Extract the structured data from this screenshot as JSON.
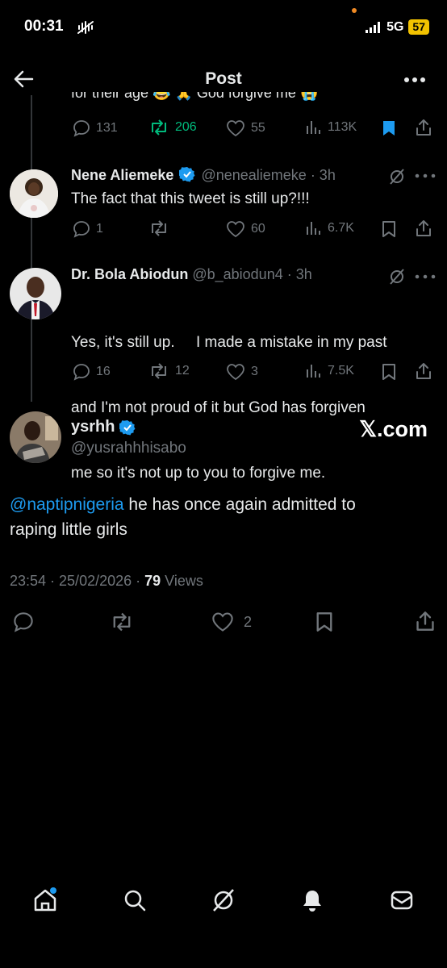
{
  "status_bar": {
    "time": "00:31",
    "network": "5G",
    "battery": "57"
  },
  "header": {
    "title": "Post"
  },
  "clipped_tweet": {
    "text": "for their age 😂 🙏 God forgive me 😭",
    "replies": "131",
    "reposts": "206",
    "likes": "55",
    "views": "113K"
  },
  "replies": [
    {
      "name": "Nene Aliemeke",
      "handle": "@nenealiemeke",
      "time": "· 3h",
      "text": "The fact that this tweet is still up?!!!",
      "replies": "1",
      "reposts": "",
      "likes": "60",
      "views": "6.7K"
    },
    {
      "name": "Dr. Bola Abiodun",
      "handle": "@b_abiodun4",
      "time": "· 3h",
      "text_lines": [
        "Yes, it's still up.     I made a mistake in my past",
        "and I'm not proud of it but God has forgiven",
        "me so it's not up to you to forgive me."
      ],
      "replies": "16",
      "reposts": "12",
      "likes": "3",
      "views": "7.5K"
    }
  ],
  "main_post": {
    "name": "ysrhh",
    "handle": "@yusrahhhisabo",
    "watermark": "𝕏.com",
    "mention": "@naptipnigeria",
    "text_after_mention": " he has once again admitted to",
    "text_line2": "raping little girls",
    "timestamp": "23:54 · 25/02/2026 · ",
    "views_count": "79",
    "views_label": " Views",
    "likes": "2"
  },
  "colors": {
    "accent": "#1d9bf0",
    "repost_active": "#00ba7c",
    "muted": "#71767b",
    "battery": "#f2c200"
  }
}
